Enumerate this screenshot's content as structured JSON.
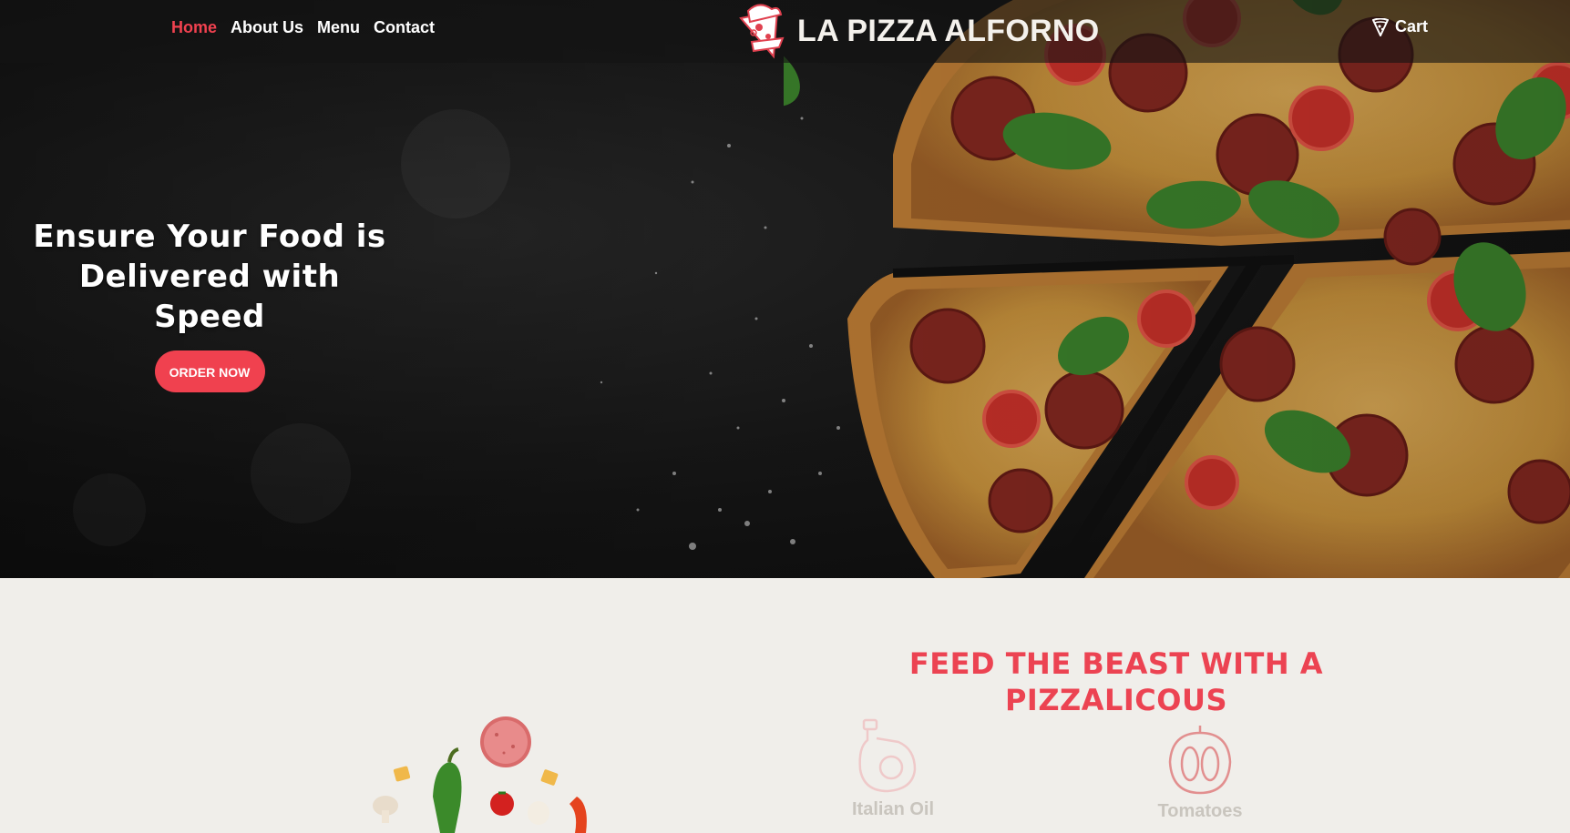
{
  "nav": {
    "links": [
      {
        "label": "Home",
        "active": true
      },
      {
        "label": "About Us",
        "active": false
      },
      {
        "label": "Menu",
        "active": false
      },
      {
        "label": "Contact",
        "active": false
      }
    ],
    "brand": "LA PIZZA ALFORNO",
    "logo_icon": "pizza-chef-logo",
    "cart_label": "Cart",
    "cart_icon": "pizza-slice-icon"
  },
  "hero": {
    "title_line1": "Ensure Your Food is",
    "title_line2": "Delivered with Speed",
    "button_label": "ORDER NOW",
    "background": "dark-slate-with-pepperoni-pizza"
  },
  "feature": {
    "title_line1": "FEED THE BEAST WITH A",
    "title_line2": "PIZZALICOUS",
    "items": [
      {
        "label": "Italian Oil",
        "icon": "oil-bottle-icon"
      },
      {
        "label": "Tomatoes",
        "icon": "tomato-icon"
      }
    ]
  },
  "colors": {
    "accent": "#f0414f",
    "section_bg": "#f0eeea",
    "nav_bg": "#141414"
  }
}
